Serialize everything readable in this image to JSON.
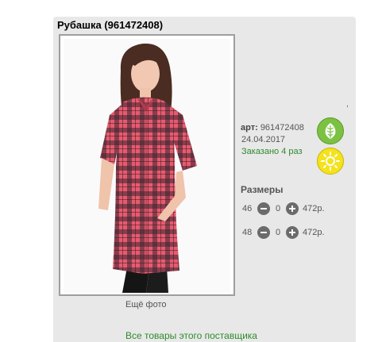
{
  "product": {
    "title": "Рубашка (961472408)",
    "more_photo_label": "Ещё фото",
    "article_label": "арт:",
    "article_number": "961472408",
    "date": "24.04.2017",
    "ordered_text": "Заказано 4 раз",
    "tick": ","
  },
  "badges": {
    "leaf_icon": "leaf-icon",
    "sun_icon": "sun-icon",
    "leaf_color": "#7bc142",
    "sun_color": "#f4e21c"
  },
  "sizes": {
    "title": "Размеры",
    "rows": [
      {
        "size": "46",
        "qty": "0",
        "price": "472р."
      },
      {
        "size": "48",
        "qty": "0",
        "price": "472р."
      }
    ]
  },
  "links": {
    "supplier": "Все товары этого поставщика"
  },
  "colors": {
    "accent_green": "#2e8b2e",
    "shirt_red": "#d94a5a"
  }
}
